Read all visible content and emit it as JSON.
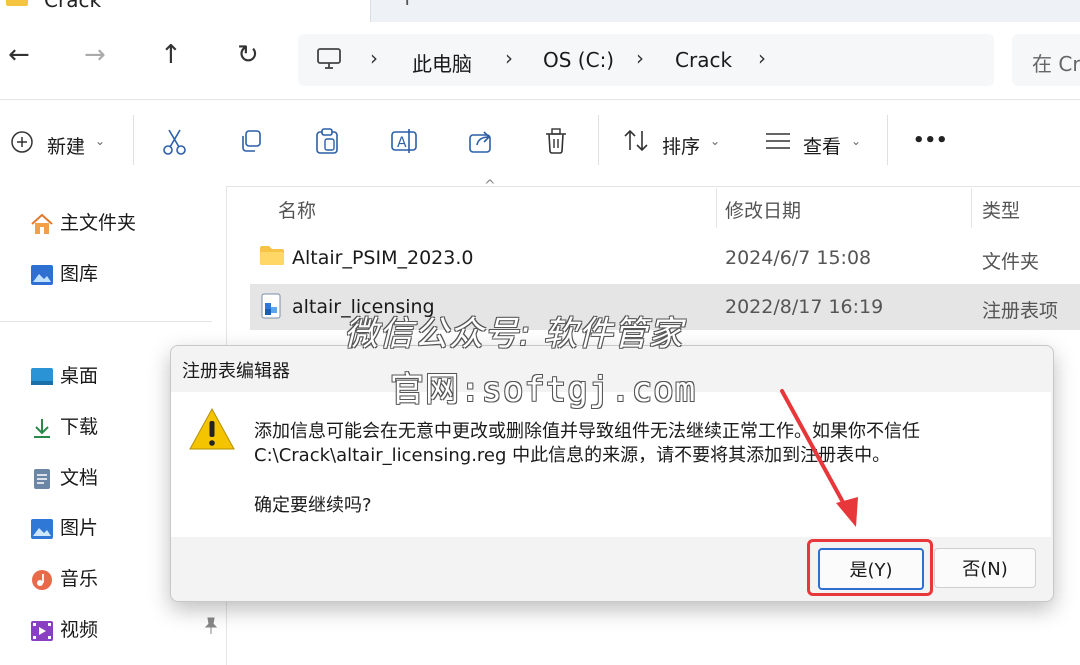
{
  "tab": {
    "title": "Crack",
    "new_tab": "+"
  },
  "nav": {
    "back": "←",
    "forward": "→",
    "up": "↑",
    "refresh": "↻"
  },
  "breadcrumb": [
    "此电脑",
    "OS (C:)",
    "Crack"
  ],
  "search": {
    "placeholder": "在 Cr"
  },
  "toolbar": {
    "new_label": "新建",
    "sort_label": "排序",
    "view_label": "查看",
    "more": "•••"
  },
  "sidebar": {
    "items": [
      {
        "label": "主文件夹",
        "icon": "home-icon"
      },
      {
        "label": "图库",
        "icon": "gallery-icon"
      },
      {
        "label": "桌面",
        "icon": "desktop-icon"
      },
      {
        "label": "下载",
        "icon": "download-icon"
      },
      {
        "label": "文档",
        "icon": "document-icon"
      },
      {
        "label": "图片",
        "icon": "pictures-icon"
      },
      {
        "label": "音乐",
        "icon": "music-icon"
      },
      {
        "label": "视频",
        "icon": "video-icon"
      }
    ]
  },
  "columns": {
    "name": "名称",
    "modified": "修改日期",
    "type": "类型"
  },
  "files": [
    {
      "name": "Altair_PSIM_2023.0",
      "date": "2024/6/7 15:08",
      "type": "文件夹",
      "icon": "folder-icon"
    },
    {
      "name": "altair_licensing",
      "date": "2022/8/17 16:19",
      "type": "注册表项",
      "icon": "registry-file-icon"
    }
  ],
  "dialog": {
    "title": "注册表编辑器",
    "line1": "添加信息可能会在无意中更改或删除值并导致组件无法继续正常工作。如果你不信任",
    "line2": "C:\\Crack\\altair_licensing.reg 中此信息的来源，请不要将其添加到注册表中。",
    "question": "确定要继续吗?",
    "yes_label": "是(Y)",
    "no_label": "否(N)",
    "warning_icon": "warning-icon"
  },
  "watermark": {
    "line1": "微信公众号: 软件管家",
    "line2": "官网:softgj.com"
  },
  "colors": {
    "accent": "#2b5fa8",
    "highlight": "#e8373b",
    "selected_row": "#e5e5e5"
  }
}
